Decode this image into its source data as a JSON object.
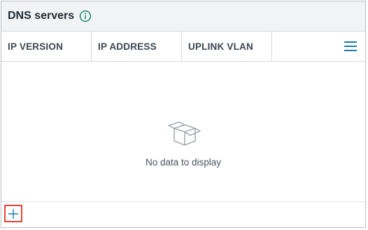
{
  "panel": {
    "title": "DNS servers",
    "info_icon": "info-circle-icon"
  },
  "table": {
    "columns": [
      "IP VERSION",
      "IP ADDRESS",
      "UPLINK VLAN"
    ],
    "menu_icon": "hamburger-menu-icon",
    "rows": [],
    "empty_icon": "empty-box-icon",
    "empty_message": "No data to display"
  },
  "footer": {
    "add_icon": "plus-icon"
  },
  "colors": {
    "accent": "#1a7ba8",
    "info_icon": "#1b8a6f",
    "header_bg": "#f1f3f4",
    "highlight": "#e0453a"
  }
}
